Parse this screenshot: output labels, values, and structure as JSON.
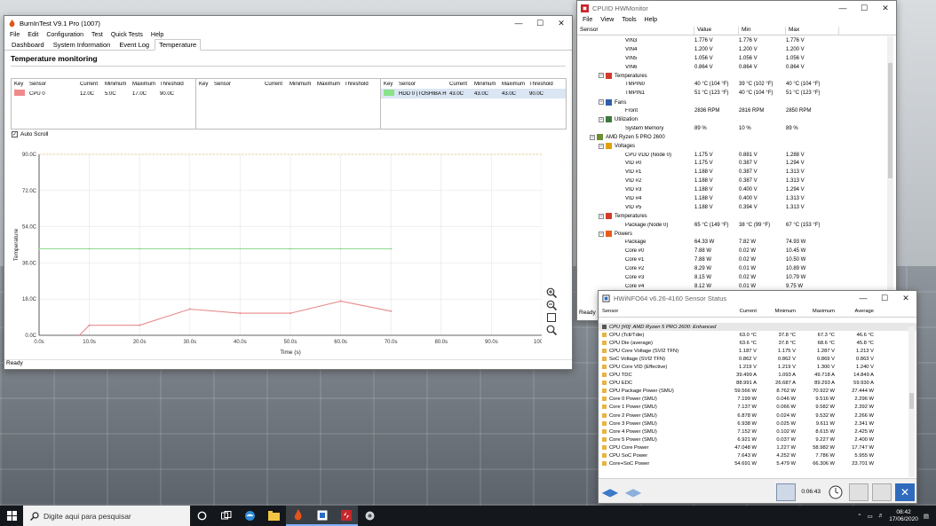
{
  "burnin": {
    "title": "BurnInTest V9.1 Pro (1007)",
    "menu": [
      "File",
      "Edit",
      "Configuration",
      "Test",
      "Quick Tests",
      "Help"
    ],
    "tabs": [
      "Dashboard",
      "System Information",
      "Event Log",
      "Temperature"
    ],
    "active_tab": "Temperature",
    "section_title": "Temperature monitoring",
    "columns": [
      "Key",
      "Sensor",
      "Current",
      "Minimum",
      "Maximum",
      "Threshold"
    ],
    "panels": [
      {
        "sensor": "CPU 0",
        "current": "12.0C",
        "minimum": "5.0C",
        "maximum": "17.0C",
        "threshold": "90.0C",
        "key_color": "#f08a8a"
      },
      null,
      {
        "sensor": "HDD 0 (TOSHIBA HD...",
        "current": "43.0C",
        "minimum": "43.0C",
        "maximum": "43.0C",
        "threshold": "90.0C",
        "key_color": "#8ae28a"
      }
    ],
    "auto_scroll_label": "Auto Scroll",
    "status": "Ready"
  },
  "chart_data": {
    "type": "line",
    "ylabel": "Temperature",
    "xlabel": "Time (s)",
    "ylim": [
      0,
      90
    ],
    "xlim": [
      0,
      100
    ],
    "y_ticks": [
      "0.0C",
      "18.0C",
      "36.0C",
      "54.0C",
      "72.0C",
      "90.0C"
    ],
    "x_ticks": [
      "0.0s",
      "10.0s",
      "20.0s",
      "30.0s",
      "40.0s",
      "50.0s",
      "60.0s",
      "70.0s",
      "80.0s",
      "90.0s",
      "100.0s"
    ],
    "threshold": 90,
    "grid": true,
    "series": [
      {
        "color": "#e88a8a",
        "x": [
          8,
          10,
          20,
          30,
          40,
          50,
          60,
          70
        ],
        "y": [
          0,
          5,
          5,
          13,
          11,
          11,
          17,
          12
        ]
      },
      {
        "color": "#8ed98e",
        "x": [
          0,
          10,
          20,
          30,
          40,
          50,
          60,
          70
        ],
        "y": [
          43,
          43,
          43,
          43,
          43,
          43,
          43,
          43
        ]
      }
    ]
  },
  "hwmon": {
    "title": "CPUID HWMonitor",
    "menu": [
      "File",
      "View",
      "Tools",
      "Help"
    ],
    "columns": [
      "Sensor",
      "Value",
      "Min",
      "Max"
    ],
    "status": "Ready",
    "rows": [
      {
        "t": "item",
        "n": "VIN3",
        "v": "1.776 V",
        "mi": "1.776 V",
        "ma": "1.776 V"
      },
      {
        "t": "item",
        "n": "VIN4",
        "v": "1.200 V",
        "mi": "1.200 V",
        "ma": "1.200 V"
      },
      {
        "t": "item",
        "n": "VIN5",
        "v": "1.056 V",
        "mi": "1.056 V",
        "ma": "1.056 V"
      },
      {
        "t": "item",
        "n": "VIN6",
        "v": "0.864 V",
        "mi": "0.864 V",
        "ma": "0.864 V"
      },
      {
        "t": "cat",
        "n": "Temperatures",
        "ico": "thermometer-icon"
      },
      {
        "t": "item",
        "n": "TMPIN0",
        "v": "40 °C  (104 °F)",
        "mi": "39 °C  (102 °F)",
        "ma": "40 °C  (104 °F)"
      },
      {
        "t": "item",
        "n": "TMPIN1",
        "v": "51 °C  (123 °F)",
        "mi": "40 °C  (104 °F)",
        "ma": "51 °C  (123 °F)"
      },
      {
        "t": "cat",
        "n": "Fans",
        "ico": "fan-icon"
      },
      {
        "t": "item",
        "n": "Front",
        "v": "2836 RPM",
        "mi": "2816 RPM",
        "ma": "2850 RPM"
      },
      {
        "t": "cat",
        "n": "Utilization",
        "ico": "utilization-icon"
      },
      {
        "t": "item",
        "n": "System Memory",
        "v": "89 %",
        "mi": "10 %",
        "ma": "89 %"
      },
      {
        "t": "dev",
        "n": "AMD Ryzen 5 PRO 2600",
        "ico": "cpu-chip-icon"
      },
      {
        "t": "cat",
        "n": "Voltages",
        "ico": "voltage-icon"
      },
      {
        "t": "item",
        "n": "CPU VDD (Node 0)",
        "v": "1.175 V",
        "mi": "0.881 V",
        "ma": "1.288 V"
      },
      {
        "t": "item",
        "n": "VID #0",
        "v": "1.175 V",
        "mi": "0.387 V",
        "ma": "1.294 V"
      },
      {
        "t": "item",
        "n": "VID #1",
        "v": "1.188 V",
        "mi": "0.387 V",
        "ma": "1.313 V"
      },
      {
        "t": "item",
        "n": "VID #2",
        "v": "1.188 V",
        "mi": "0.387 V",
        "ma": "1.313 V"
      },
      {
        "t": "item",
        "n": "VID #3",
        "v": "1.188 V",
        "mi": "0.400 V",
        "ma": "1.294 V"
      },
      {
        "t": "item",
        "n": "VID #4",
        "v": "1.188 V",
        "mi": "0.400 V",
        "ma": "1.313 V"
      },
      {
        "t": "item",
        "n": "VID #5",
        "v": "1.188 V",
        "mi": "0.394 V",
        "ma": "1.313 V"
      },
      {
        "t": "cat",
        "n": "Temperatures",
        "ico": "thermometer-icon"
      },
      {
        "t": "item",
        "n": "Package (Node 0)",
        "v": "65 °C  (149 °F)",
        "mi": "38 °C  (99 °F)",
        "ma": "67 °C  (153 °F)"
      },
      {
        "t": "cat",
        "n": "Powers",
        "ico": "power-icon"
      },
      {
        "t": "item",
        "n": "Package",
        "v": "64.33 W",
        "mi": "7.82 W",
        "ma": "74.93 W"
      },
      {
        "t": "item",
        "n": "Core #0",
        "v": "7.88 W",
        "mi": "0.02 W",
        "ma": "10.45 W"
      },
      {
        "t": "item",
        "n": "Core #1",
        "v": "7.88 W",
        "mi": "0.02 W",
        "ma": "10.50 W"
      },
      {
        "t": "item",
        "n": "Core #2",
        "v": "8.29 W",
        "mi": "0.01 W",
        "ma": "10.89 W"
      },
      {
        "t": "item",
        "n": "Core #3",
        "v": "8.15 W",
        "mi": "0.02 W",
        "ma": "10.79 W"
      },
      {
        "t": "item",
        "n": "Core #4",
        "v": "8.12 W",
        "mi": "0.01 W",
        "ma": "9.75 W"
      }
    ]
  },
  "hwinfo": {
    "title": "HWiNFO64 v6.26-4160 Sensor Status",
    "columns": [
      "Sensor",
      "Current",
      "Minimum",
      "Maximum",
      "Average"
    ],
    "section": "CPU [#0]: AMD Ryzen 5 PRO 2600: Enhanced",
    "elapsed": "0:06:43",
    "rows": [
      [
        "CPU (Tctl/Tdie)",
        "63.0 °C",
        "37.8 °C",
        "67.3 °C",
        "46.6 °C"
      ],
      [
        "CPU Die (average)",
        "63.6 °C",
        "37.8 °C",
        "68.6 °C",
        "45.8 °C"
      ],
      [
        "CPU Core Voltage (SVI2 TFN)",
        "1.187 V",
        "1.175 V",
        "1.287 V",
        "1.213 V"
      ],
      [
        "SoC Voltage (SVI2 TFN)",
        "0.862 V",
        "0.862 V",
        "0.869 V",
        "0.863 V"
      ],
      [
        "CPU Core VID (Effective)",
        "1.219 V",
        "1.219 V",
        "1.300 V",
        "1.240 V"
      ],
      [
        "CPU TDC",
        "39.499 A",
        "1.093 A",
        "49.718 A",
        "14.849 A"
      ],
      [
        "CPU EDC",
        "88.991 A",
        "26.687 A",
        "89.293 A",
        "59.930 A"
      ],
      [
        "CPU Package Power (SMU)",
        "59.566 W",
        "8.762 W",
        "70.922 W",
        "27.444 W"
      ],
      [
        "Core 0 Power (SMU)",
        "7.199 W",
        "0.046 W",
        "9.516 W",
        "2.296 W"
      ],
      [
        "Core 1 Power (SMU)",
        "7.137 W",
        "0.066 W",
        "9.582 W",
        "2.392 W"
      ],
      [
        "Core 2 Power (SMU)",
        "6.878 W",
        "0.024 W",
        "9.532 W",
        "2.266 W"
      ],
      [
        "Core 3 Power (SMU)",
        "6.938 W",
        "0.025 W",
        "9.611 W",
        "2.341 W"
      ],
      [
        "Core 4 Power (SMU)",
        "7.152 W",
        "0.102 W",
        "8.615 W",
        "2.425 W"
      ],
      [
        "Core 5 Power (SMU)",
        "6.921 W",
        "0.037 W",
        "9.227 W",
        "2.400 W"
      ],
      [
        "CPU Core Power",
        "47.048 W",
        "1.227 W",
        "58.982 W",
        "17.747 W"
      ],
      [
        "CPU SoC Power",
        "7.643 W",
        "4.252 W",
        "7.786 W",
        "5.955 W"
      ],
      [
        "Core+SoC Power",
        "54.691 W",
        "5.479 W",
        "66.306 W",
        "23.701 W"
      ]
    ]
  },
  "taskbar": {
    "search_placeholder": "Digite aqui para pesquisar",
    "time": "08:42",
    "date": "17/06/2020"
  }
}
